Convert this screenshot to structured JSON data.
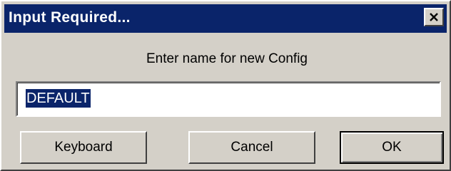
{
  "dialog": {
    "title": "Input Required...",
    "prompt": "Enter name for new Config",
    "input_value": "DEFAULT"
  },
  "buttons": {
    "keyboard": "Keyboard",
    "cancel": "Cancel",
    "ok": "OK"
  },
  "icons": {
    "close": "close-icon"
  },
  "colors": {
    "titlebar": "#0a246a",
    "face": "#d4d0c8",
    "selection": "#0a246a"
  }
}
